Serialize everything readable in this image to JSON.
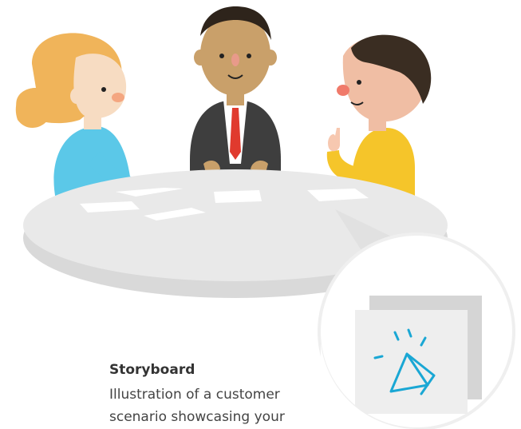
{
  "caption": {
    "title": "Storyboard",
    "line1": "Illustration of a customer",
    "line2": "scenario showcasing your"
  },
  "colors": {
    "table": "#e9e9e9",
    "table_shadow": "#d9d9d9",
    "woman_shirt": "#5bc8e8",
    "woman_hair": "#f0b45a",
    "skin_light": "#f7dcc2",
    "man_center_skin": "#c9a06a",
    "suit": "#3e3e3e",
    "tie": "#e03a2e",
    "man_right_shirt": "#f5c52a",
    "man_right_hair": "#3a2d22",
    "paper": "#ffffff",
    "icon_stroke": "#1aa7d4"
  },
  "icons": {
    "storyboard_cards": "storyboard-cards-icon",
    "tent": "tent-sparkle-icon"
  }
}
